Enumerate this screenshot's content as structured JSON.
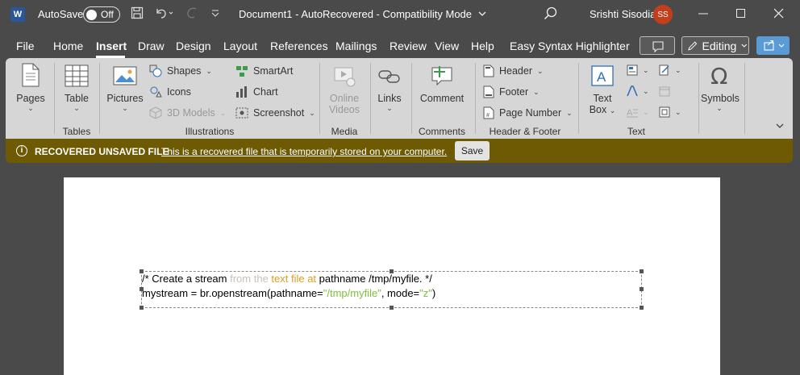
{
  "titlebar": {
    "app_logo": "W",
    "autosave_label": "AutoSave",
    "autosave_state": "Off",
    "document_title": "Document1  -  AutoRecovered  -  Compatibility Mode",
    "user_name": "Srishti Sisodia",
    "user_initials": "SS"
  },
  "menu": {
    "tabs": [
      "File",
      "Home",
      "Insert",
      "Draw",
      "Design",
      "Layout",
      "References",
      "Mailings",
      "Review",
      "View",
      "Help",
      "Easy Syntax Highlighter"
    ],
    "active_tab": "Insert",
    "editing_label": "Editing"
  },
  "ribbon": {
    "pages": "Pages",
    "table": "Table",
    "tables_group": "Tables",
    "pictures": "Pictures",
    "shapes": "Shapes",
    "icons": "Icons",
    "models3d": "3D Models",
    "smartart": "SmartArt",
    "chart": "Chart",
    "screenshot": "Screenshot",
    "illustrations_group": "Illustrations",
    "online_videos_1": "Online",
    "online_videos_2": "Videos",
    "media_group": "Media",
    "links": "Links",
    "comment": "Comment",
    "comments_group": "Comments",
    "header": "Header",
    "footer": "Footer",
    "page_number": "Page Number",
    "header_footer_group": "Header & Footer",
    "text_box_1": "Text",
    "text_box_2": "Box",
    "text_group": "Text",
    "symbols": "Symbols"
  },
  "infobar": {
    "title": "RECOVERED UNSAVED FILE",
    "message": "This is a recovered file that is temporarily stored on your computer.",
    "save_label": "Save"
  },
  "document": {
    "line1": {
      "part1": "/* Create a stream ",
      "part2": "from the ",
      "part3": "text file at ",
      "part4": "pathname /tmp/myfile. */"
    },
    "line2": {
      "part1": "mystream = br.openstream(pathname=",
      "part2": "\"/tmp/myfile\"",
      "part3": ", mode=",
      "part4": "\"z\"",
      "part5": ")"
    }
  }
}
